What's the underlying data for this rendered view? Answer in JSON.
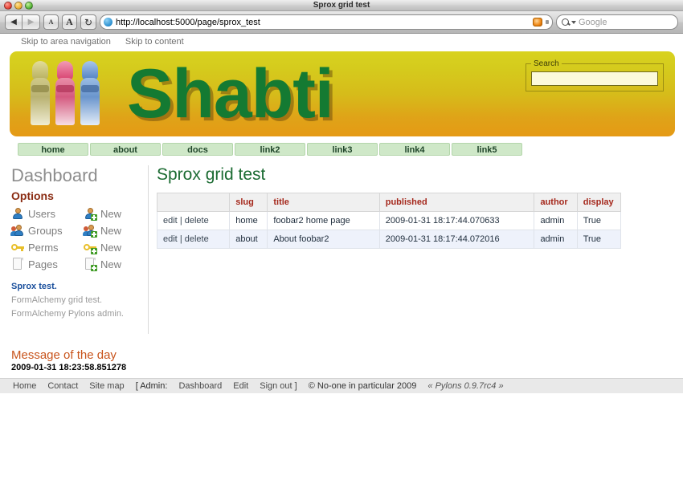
{
  "window": {
    "title": "Sprox grid test",
    "traffic_lights": [
      "close-red",
      "minimize-yellow",
      "zoom-green"
    ]
  },
  "toolbar": {
    "back_label": "◀",
    "forward_label": "▶",
    "text_smaller_label": "A",
    "text_larger_label": "A",
    "reload_label": "↻",
    "url": "http://localhost:5000/page/sprox_test",
    "rss_icon": "rss-icon",
    "search_placeholder": "Google",
    "search_value": ""
  },
  "skip_links": [
    {
      "label": "Skip to area navigation"
    },
    {
      "label": "Skip to content"
    }
  ],
  "banner": {
    "wordmark": "Shabti",
    "figure_count": 3,
    "search": {
      "legend": "Search",
      "value": "",
      "placeholder": ""
    },
    "colors": {
      "gradient_top": "#d8d21f",
      "gradient_bottom": "#e59a15",
      "wordmark_green": "#147a32"
    }
  },
  "nav": {
    "items": [
      {
        "label": "home"
      },
      {
        "label": "about"
      },
      {
        "label": "docs"
      },
      {
        "label": "link2"
      },
      {
        "label": "link3"
      },
      {
        "label": "link4"
      },
      {
        "label": "link5"
      }
    ]
  },
  "sidebar": {
    "title": "Dashboard",
    "options_title": "Options",
    "options": [
      {
        "label": "Users",
        "icon": "user-icon",
        "new_label": "New",
        "new_icon": "user-add-icon"
      },
      {
        "label": "Groups",
        "icon": "group-icon",
        "new_label": "New",
        "new_icon": "group-add-icon"
      },
      {
        "label": "Perms",
        "icon": "key-icon",
        "new_label": "New",
        "new_icon": "key-add-icon"
      },
      {
        "label": "Pages",
        "icon": "page-icon",
        "new_label": "New",
        "new_icon": "page-add-icon"
      }
    ],
    "links": [
      {
        "label": "Sprox test.",
        "style": "primary"
      },
      {
        "label": "FormAlchemy grid test.",
        "style": "muted"
      },
      {
        "label": "FormAlchemy Pylons admin.",
        "style": "muted"
      }
    ]
  },
  "main": {
    "title": "Sprox grid test",
    "table": {
      "columns": [
        "",
        "slug",
        "title",
        "published",
        "author",
        "display"
      ],
      "rows": [
        {
          "actions_edit": "edit",
          "actions_sep": "|",
          "actions_delete": "delete",
          "slug": "home",
          "title": "foobar2 home page",
          "published": "2009-01-31 18:17:44.070633",
          "author": "admin",
          "display": "True"
        },
        {
          "actions_edit": "edit",
          "actions_sep": "|",
          "actions_delete": "delete",
          "slug": "about",
          "title": "About foobar2",
          "published": "2009-01-31 18:17:44.072016",
          "author": "admin",
          "display": "True"
        }
      ]
    }
  },
  "motd": {
    "title": "Message of the day",
    "timestamp": "2009-01-31 18:23:58.851278"
  },
  "footer": {
    "home": "Home",
    "contact": "Contact",
    "sitemap": "Site map",
    "admin_open": "[ Admin:",
    "admin_dashboard": "Dashboard",
    "admin_edit": "Edit",
    "admin_signout": "Sign out ]",
    "copyright": "© No-one in particular 2009",
    "powered_by": "« Pylons 0.9.7rc4 »"
  }
}
